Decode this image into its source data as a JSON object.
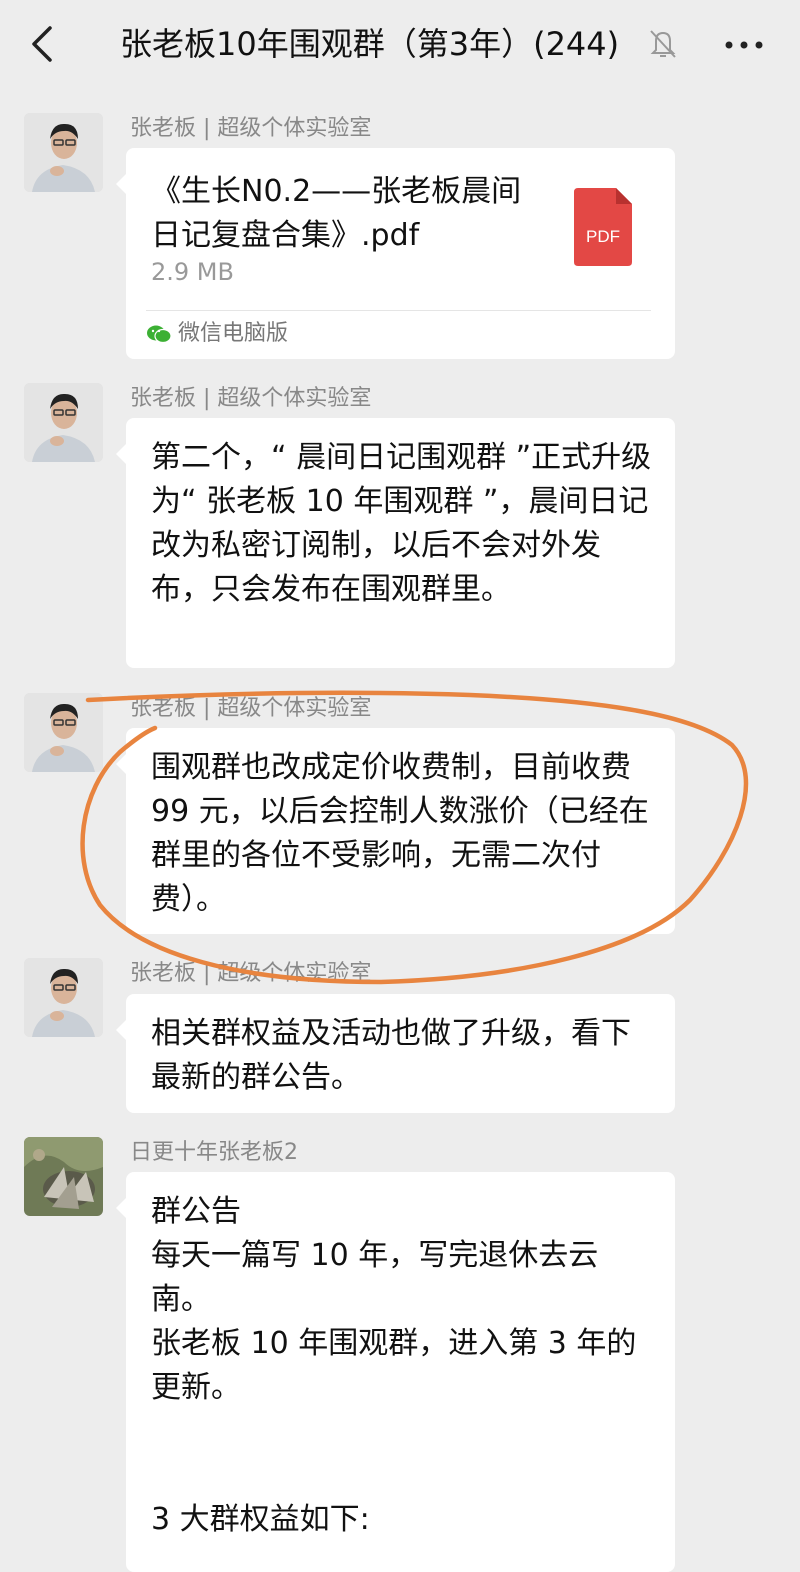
{
  "header": {
    "title": "张老板10年围观群（第3年）(244)",
    "back_icon": "chevron-left-icon",
    "mute_icon": "bell-off-icon",
    "more_icon": "more-horizontal-icon"
  },
  "messages": [
    {
      "sender": "张老板 | 超级个体实验室",
      "type": "file",
      "file_name": "《生长N0.2——张老板晨间日记复盘合集》.pdf",
      "file_size": "2.9 MB",
      "file_icon_label": "PDF",
      "source": "微信电脑版"
    },
    {
      "sender": "张老板 | 超级个体实验室",
      "type": "text",
      "text": "第二个，“ 晨间日记围观群 ”正式升级为“ 张老板 10 年围观群 ”，晨间日记改为私密订阅制，以后不会对外发布，只会发布在围观群里。"
    },
    {
      "sender": "张老板 | 超级个体实验室",
      "type": "text",
      "text": "围观群也改成定价收费制，目前收费 99 元，以后会控制人数涨价（已经在群里的各位不受影响，无需二次付费）。"
    },
    {
      "sender": "张老板 | 超级个体实验室",
      "type": "text",
      "text": "相关群权益及活动也做了升级，看下最新的群公告。"
    },
    {
      "sender": "日更十年张老板2",
      "type": "announcement",
      "lines": [
        "群公告",
        "每天一篇写 10 年，写完退休去云南。",
        "张老板 10 年围观群，进入第 3 年的更新。",
        "",
        "",
        "3 大群权益如下:"
      ]
    }
  ],
  "colors": {
    "background": "#ededed",
    "bubble": "#ffffff",
    "annotation": "#e8843f",
    "pdf_red": "#e34845",
    "wechat_green": "#3cb034"
  }
}
